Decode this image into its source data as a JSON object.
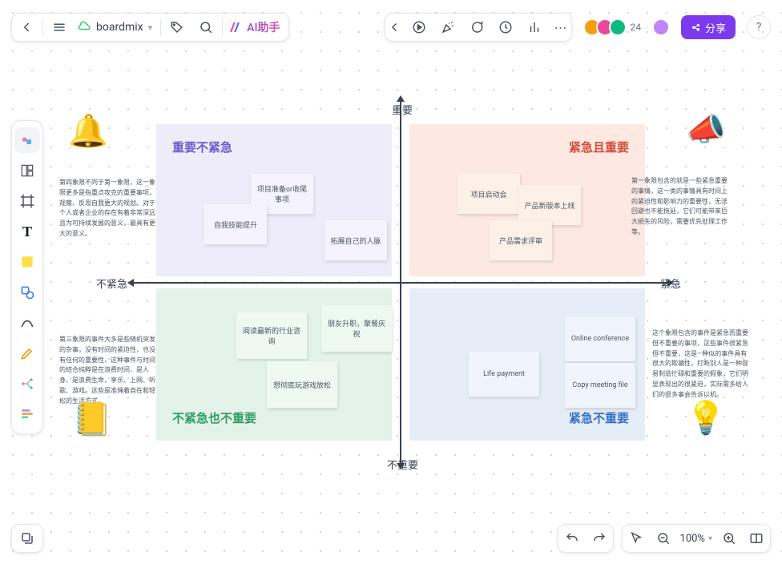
{
  "header": {
    "doc_title": "boardmix",
    "ai_label": "AI助手",
    "avatar_count": "24",
    "share_label": "分享"
  },
  "axes": {
    "top": "重要",
    "bottom": "不重要",
    "left": "不紧急",
    "right": "紧急"
  },
  "quadrants": {
    "tl": {
      "title": "重要不紧急",
      "color": "#6b5bd2"
    },
    "tr": {
      "title": "紧急且重要",
      "color": "#d84a3b"
    },
    "bl": {
      "title": "不紧急也不重要",
      "color": "#2f9e63"
    },
    "br": {
      "title": "紧急不重要",
      "color": "#3470c9"
    }
  },
  "notes": {
    "tl": [
      "项目准备or收尾事项",
      "自我技能提升",
      "拓展自己的人脉"
    ],
    "tr": [
      "项目启动会",
      "产品新版本上线",
      "产品需求评审"
    ],
    "bl": [
      "阅读最新的行业咨询",
      "朋友升职，聚餐庆祝",
      "想彻底玩游戏放松"
    ],
    "br": [
      "Online conference",
      "Life payment",
      "Copy meeting file"
    ]
  },
  "commentary": {
    "tl_outside": "第四象限不同于第一象限，这一象限更多是指重点攻克的重要事项，观察、反思自我更大的规划。对于个人或者企业的存在有着非常深远且为可持续发展的意义，最具有更大的意义。",
    "tr_outside": "第一象限包含的就是一些紧急重要的事情，这一类的事情具有时间上的紧迫性和影响力的重要性，无法回避也不能拖延，它们可能带来巨大损失的风险，需要优先处理工作等。",
    "bl_outside": "第三象限的事件大多是些随机突发的杂事，没有时间的紧迫性，也没有任何的重要性，这种事件与时间的结合纯粹是在浪费时间，是人身、是浪费生命，享乐、上网、听歌、游戏。这些是准绳着自在和轻松的生活方式。",
    "br_outside": "这个象限包含的事件是紧急而重要但不重要的事项，这些事件很紧急但不重要，这是—种似的事件具有很大的欺骗性，打断别人是一种容易制造忙碌和重要的假象，它们明显表现出的很紧迫，实际需多给人们的很多事会告诉以机。"
  },
  "bottombar": {
    "zoom": "100%"
  }
}
